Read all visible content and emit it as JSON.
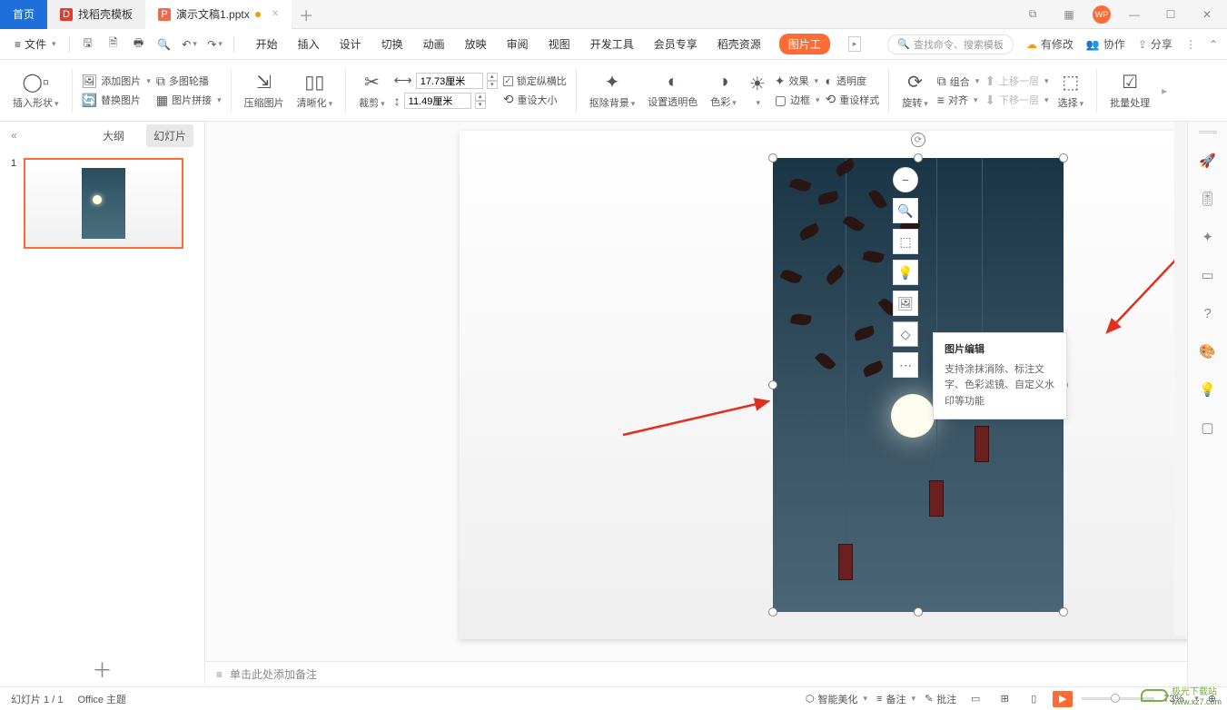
{
  "titlebar": {
    "home": "首页",
    "templates": "找稻壳模板",
    "doc": "演示文稿1.pptx",
    "wp_badge": "WP"
  },
  "menurow": {
    "file": "文件",
    "tabs": [
      "开始",
      "插入",
      "设计",
      "切换",
      "动画",
      "放映",
      "审阅",
      "视图",
      "开发工具",
      "会员专享",
      "稻壳资源",
      "图片工"
    ],
    "search_placeholder": "查找命令、搜索模板",
    "right": {
      "pending": "有修改",
      "coop": "协作",
      "share": "分享"
    }
  },
  "ribbon": {
    "insert_shape": "插入形状",
    "add_image": "添加图片",
    "multi_outline": "多图轮播",
    "replace_image": "替换图片",
    "image_stitch": "图片拼接",
    "compress": "压缩图片",
    "clarity": "清晰化",
    "crop": "裁剪",
    "width_val": "17.73厘米",
    "height_val": "11.49厘米",
    "lock_ratio": "锁定纵横比",
    "reset_size": "重设大小",
    "remove_bg": "抠除背景",
    "set_transparent": "设置透明色",
    "color": "色彩",
    "effects": "效果",
    "transparency": "透明度",
    "border": "边框",
    "reset_style": "重设样式",
    "rotate": "旋转",
    "combine": "组合",
    "align": "对齐",
    "move_up": "上移一层",
    "move_down": "下移一层",
    "select": "选择",
    "batch": "批量处理"
  },
  "slidepanel": {
    "outline": "大纲",
    "slides": "幻灯片",
    "thumb_num": "1"
  },
  "tooltip": {
    "title": "图片编辑",
    "body": "支持涂抹消除、标注文字、色彩滤镜、自定义水印等功能"
  },
  "float_tools": [
    "−",
    "🔍",
    "⬚",
    "💡",
    "🖼",
    "◇",
    "⋯"
  ],
  "notes_placeholder": "单击此处添加备注",
  "statusbar": {
    "slide_info": "幻灯片 1 / 1",
    "theme": "Office 主题",
    "beautify": "智能美化",
    "notes": "备注",
    "comments": "批注",
    "zoom": "73%"
  },
  "watermark": {
    "site": "极光下载站",
    "url": "www.xz7.com"
  }
}
